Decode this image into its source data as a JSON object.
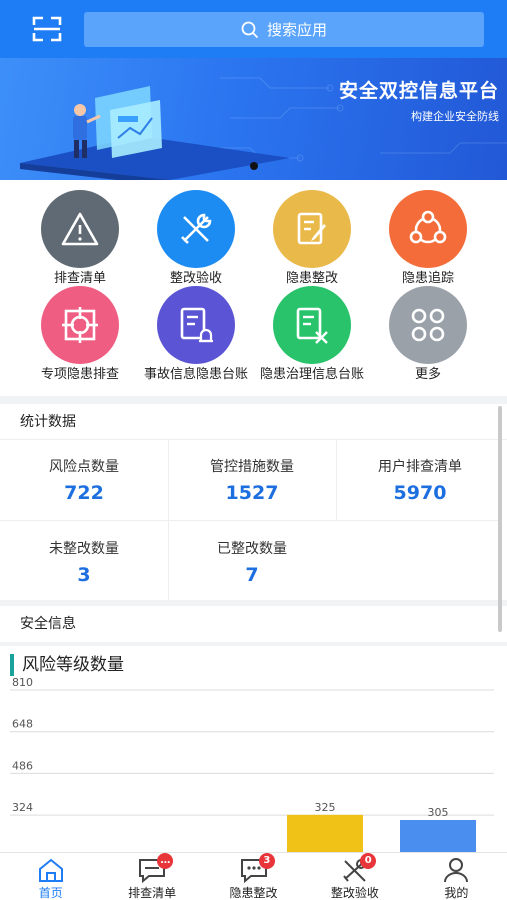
{
  "search": {
    "label": "搜索应用"
  },
  "banner": {
    "title": "安全双控信息平台",
    "subtitle": "构建企业安全防线"
  },
  "menu": {
    "items": [
      {
        "label": "排查清单",
        "icon": "warning-icon",
        "color": "#5f6a74"
      },
      {
        "label": "整改验收",
        "icon": "tools-icon",
        "color": "#1c8cf2"
      },
      {
        "label": "隐患整改",
        "icon": "edit-doc-icon",
        "color": "#e9b94a"
      },
      {
        "label": "隐患追踪",
        "icon": "share-circle-icon",
        "color": "#f36c3a"
      },
      {
        "label": "专项隐患排查",
        "icon": "target-icon",
        "color": "#ef5e82"
      },
      {
        "label": "事故信息隐患台账",
        "icon": "doc-alarm-icon",
        "color": "#5b55d6"
      },
      {
        "label": "隐患治理信息台账",
        "icon": "doc-tools-icon",
        "color": "#28c36a"
      },
      {
        "label": "更多",
        "icon": "grid-more-icon",
        "color": "#9aa1a9"
      }
    ]
  },
  "stats": {
    "title": "统计数据",
    "items": [
      {
        "label": "风险点数量",
        "value": "722"
      },
      {
        "label": "管控措施数量",
        "value": "1527"
      },
      {
        "label": "用户排查清单",
        "value": "5970"
      },
      {
        "label": "未整改数量",
        "value": "3"
      },
      {
        "label": "已整改数量",
        "value": "7"
      }
    ]
  },
  "safety": {
    "title": "安全信息"
  },
  "chart_data": {
    "type": "bar",
    "title": "风险等级数量",
    "yticks": [
      "810",
      "648",
      "486",
      "324"
    ],
    "ylim": [
      0,
      810
    ],
    "grid": true,
    "series": [
      {
        "value": 325,
        "label": "325",
        "color": "#f0c117"
      },
      {
        "value": 305,
        "label": "305",
        "color": "#4a8ff0"
      }
    ]
  },
  "nav": {
    "items": [
      {
        "label": "首页",
        "badge": ""
      },
      {
        "label": "排查清单",
        "badge": "…"
      },
      {
        "label": "隐患整改",
        "badge": "3"
      },
      {
        "label": "整改验收",
        "badge": "0"
      },
      {
        "label": "我的",
        "badge": ""
      }
    ]
  }
}
